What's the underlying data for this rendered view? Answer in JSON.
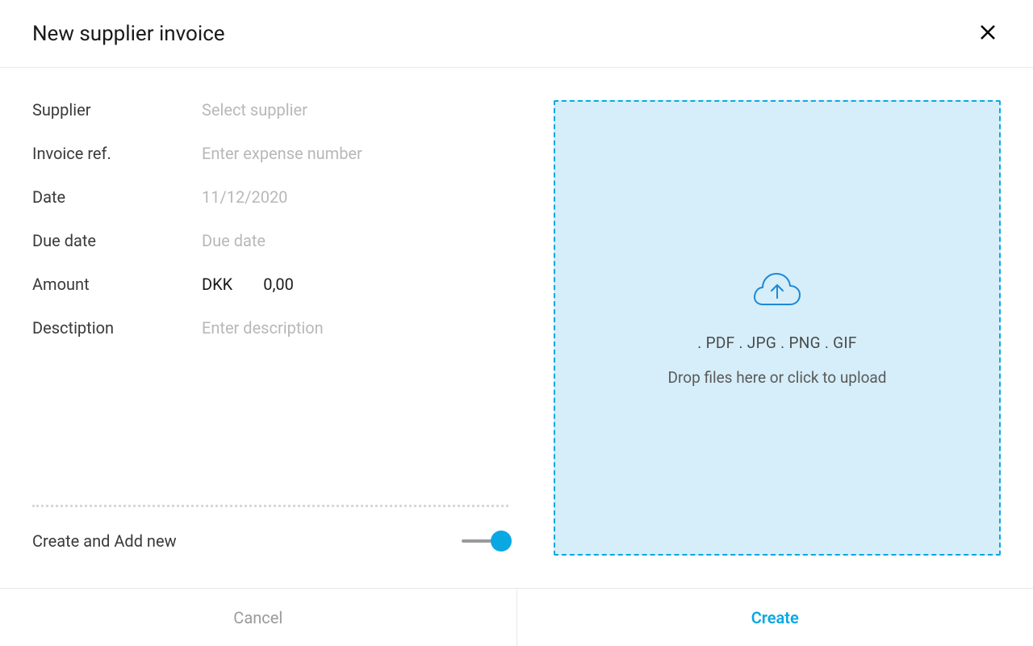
{
  "header": {
    "title": "New supplier invoice"
  },
  "form": {
    "supplier": {
      "label": "Supplier",
      "placeholder": "Select supplier",
      "value": ""
    },
    "invoice_ref": {
      "label": "Invoice ref.",
      "placeholder": "Enter expense number",
      "value": ""
    },
    "date": {
      "label": "Date",
      "value": "11/12/2020"
    },
    "due_date": {
      "label": "Due date",
      "placeholder": "Due date",
      "value": ""
    },
    "amount": {
      "label": "Amount",
      "currency": "DKK",
      "value": "0,00"
    },
    "description": {
      "label": "Desctiption",
      "placeholder": "Enter description",
      "value": ""
    }
  },
  "toggle": {
    "label": "Create and Add new",
    "on": true
  },
  "upload": {
    "filetypes": ". PDF  . JPG  . PNG . GIF",
    "hint": "Drop files here or click to upload"
  },
  "footer": {
    "cancel": "Cancel",
    "create": "Create"
  }
}
